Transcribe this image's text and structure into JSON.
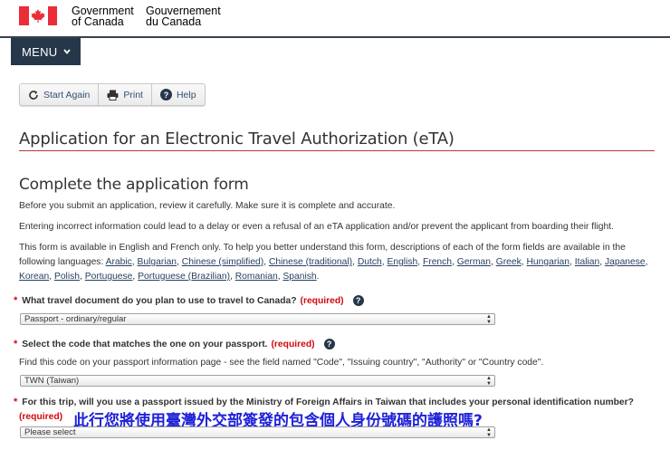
{
  "header": {
    "signature_en_line1": "Government",
    "signature_en_line2": "of Canada",
    "signature_fr_line1": "Gouvernement",
    "signature_fr_line2": "du Canada",
    "flag_color": "#eb2d37"
  },
  "menu": {
    "label": "MENU",
    "icon": "chevron-down-icon"
  },
  "toolbar": {
    "start_again": "Start Again",
    "print": "Print",
    "help": "Help"
  },
  "page": {
    "title": "Application for an Electronic Travel Authorization (eTA)",
    "subtitle": "Complete the application form",
    "para1": "Before you submit an application, review it carefully. Make sure it is complete and accurate.",
    "para2": "Entering incorrect information could lead to a delay or even a refusal of an eTA application and/or prevent the applicant from boarding their flight.",
    "para3_line1": "This form is available in English and French only. To help you better understand this form, descriptions of each of the form fields are available in the",
    "para3_lead": "following languages:",
    "languages": [
      "Arabic",
      "Bulgarian",
      "Chinese (simplified)",
      "Chinese (traditional)",
      "Dutch",
      "English",
      "French",
      "German",
      "Greek",
      "Hungarian",
      "Italian",
      "Japanese",
      "Korean",
      "Polish",
      "Portuguese",
      "Portuguese (Brazilian)",
      "Romanian",
      "Spanish"
    ]
  },
  "form": {
    "required_marker": "*",
    "required_text": "(required)",
    "q1_label": "What travel document do you plan to use to travel to Canada?",
    "q1_value": "Passport - ordinary/regular",
    "q2_label": "Select the code that matches the one on your passport.",
    "q2_hint": "Find this code on your passport information page - see the field named \"Code\", \"Issuing country\", \"Authority\" or \"Country code\".",
    "q2_value": "TWN (Taiwan)",
    "q3_label": "For this trip, will you use a passport issued by the Ministry of Foreign Affairs in Taiwan that includes your personal identification number?",
    "q3_value": "Please select",
    "help_glyph": "?"
  },
  "annotation": {
    "text": "此行您將使用臺灣外交部簽發的包含個人身份號碼的護照嗎?",
    "color": "#1e22d8"
  }
}
